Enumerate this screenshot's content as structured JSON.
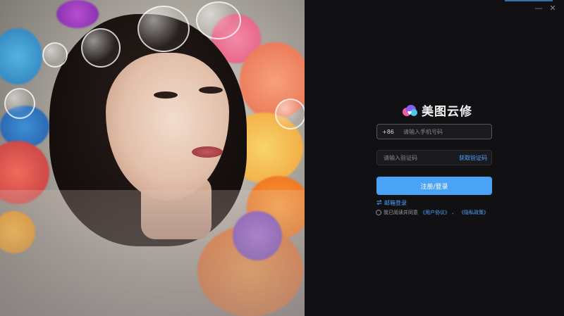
{
  "window": {
    "minimize_glyph": "—",
    "close_glyph": "✕"
  },
  "brand": {
    "name": "美图云修",
    "logo_icon": "cloud-heart-logo-icon",
    "colors": {
      "pink": "#ef5fa6",
      "blue": "#4cc7f0",
      "purple": "#8a5cf0"
    }
  },
  "form": {
    "country_code": "+86",
    "phone_placeholder": "请输入手机号码",
    "code_placeholder": "请输入验证码",
    "get_code_label": "获取验证码",
    "submit_label": "注册/登录",
    "email_login_label": "邮箱登录",
    "email_login_icon": "swap-icon"
  },
  "agreement": {
    "prefix": "我已阅读并同意",
    "user_agreement": "《用户协议》",
    "separator": "、",
    "privacy_policy": "《隐私政策》"
  },
  "accent_color": "#4ba3f5"
}
